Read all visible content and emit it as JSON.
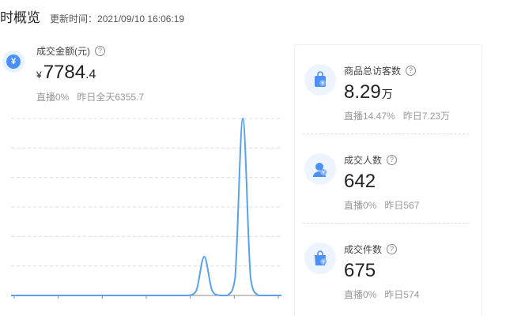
{
  "header": {
    "title": "时概览",
    "updated_label": "更新时间：",
    "updated_time": "2021/09/10 16:06:19"
  },
  "gmv": {
    "label": "成交金额(元)",
    "currency": "¥",
    "value_int": "7784",
    "value_dec": ".4",
    "live_share": "直播0%",
    "yesterday": "昨日全天6355.7",
    "icon": "yuan-icon"
  },
  "cards": [
    {
      "label": "商品总访客数",
      "value": "8.29",
      "unit": "万",
      "live_share": "直播14.47%",
      "yesterday": "昨日7.23万",
      "icon": "shopping-bag-icon"
    },
    {
      "label": "成交人数",
      "value": "642",
      "unit": "",
      "live_share": "直播0%",
      "yesterday": "昨日567",
      "icon": "user-yuan-icon"
    },
    {
      "label": "成交件数",
      "value": "675",
      "unit": "",
      "live_share": "直播0%",
      "yesterday": "昨日574",
      "icon": "bag-yuan-icon"
    }
  ],
  "colors": {
    "accent": "#4a90f7",
    "line": "#5aa0ea",
    "grid": "#dddddd",
    "muted": "#999999"
  },
  "chart_data": {
    "type": "line",
    "title": "",
    "xlabel": "",
    "ylabel": "",
    "x": [
      0,
      1,
      2,
      3,
      4,
      5,
      6,
      7,
      8,
      9,
      10,
      11,
      12,
      13,
      14,
      15,
      16,
      17,
      18,
      19,
      20,
      21,
      22,
      23,
      24,
      25,
      26,
      27,
      28,
      29,
      30,
      31,
      32,
      33,
      34,
      35
    ],
    "series": [
      {
        "values": [
          0,
          0,
          0,
          0,
          0,
          0,
          0,
          0,
          0,
          0,
          0,
          0,
          0,
          0,
          0,
          0,
          0,
          0,
          0,
          0,
          0,
          0,
          0,
          0,
          3,
          22,
          3,
          0,
          0,
          10,
          100,
          10,
          0,
          0,
          0,
          0
        ]
      }
    ],
    "ylim": [
      0,
      100
    ],
    "grid": true,
    "gridlines": 6,
    "xticks": 7
  }
}
